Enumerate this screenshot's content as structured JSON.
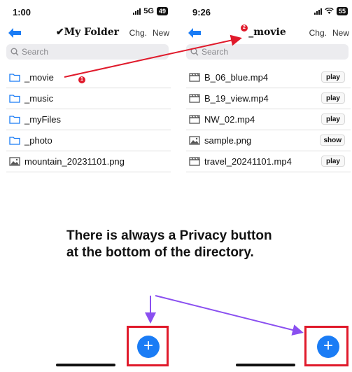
{
  "left_screen": {
    "status": {
      "time": "1:00",
      "network": "5G",
      "battery": "49"
    },
    "nav": {
      "title": "✔My Folder",
      "chg": "Chg.",
      "new": "New"
    },
    "search_placeholder": "Search",
    "items": [
      {
        "name": "_movie",
        "icon": "folder-icon"
      },
      {
        "name": "_music",
        "icon": "folder-icon"
      },
      {
        "name": "_myFiles",
        "icon": "folder-icon"
      },
      {
        "name": "_photo",
        "icon": "folder-icon"
      },
      {
        "name": "mountain_20231101.png",
        "icon": "image-icon"
      }
    ]
  },
  "right_screen": {
    "status": {
      "time": "9:26",
      "battery": "55"
    },
    "nav": {
      "title": "_movie",
      "chg": "Chg.",
      "new": "New"
    },
    "search_placeholder": "Search",
    "items": [
      {
        "name": "B_06_blue.mp4",
        "icon": "video-icon",
        "action": "play"
      },
      {
        "name": "B_19_view.mp4",
        "icon": "video-icon",
        "action": "play"
      },
      {
        "name": "NW_02.mp4",
        "icon": "video-icon",
        "action": "play"
      },
      {
        "name": "sample.png",
        "icon": "image-icon",
        "action": "show"
      },
      {
        "name": "travel_20241101.mp4",
        "icon": "video-icon",
        "action": "play"
      }
    ]
  },
  "annotation": {
    "text": "There is always a Privacy button at the bottom of the directory.",
    "badge_1": "1",
    "badge_2": "2",
    "fab_symbol": "+"
  },
  "colors": {
    "accent": "#1a7cf5",
    "highlight": "#e01a2b",
    "arrow_purple": "#8a4ff0"
  }
}
